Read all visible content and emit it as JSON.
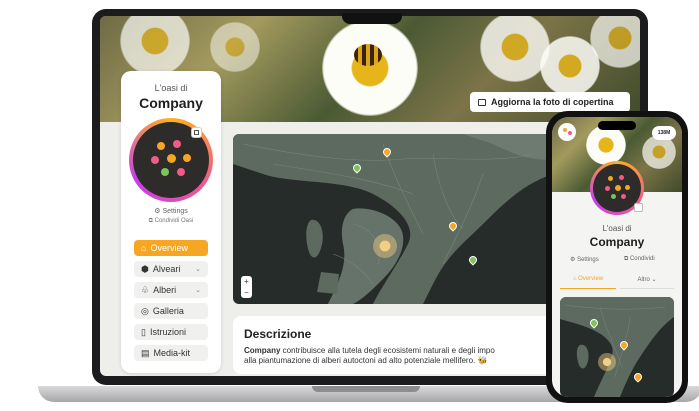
{
  "brand": {
    "accent": "#f7a623",
    "avatar_ring": [
      "#ffb21e",
      "#f15b86",
      "#c73cf0"
    ]
  },
  "desktop": {
    "cover_button": {
      "icon": "image-icon",
      "label": "Aggiorna la foto di copertina"
    },
    "sidebar": {
      "subtitle": "L'oasi di",
      "title": "Company",
      "settings": {
        "icon": "settings-icon",
        "label": "Settings"
      },
      "share": {
        "icon": "share-icon",
        "label": "Condividi Oasi"
      },
      "menu": [
        {
          "icon": "home-icon",
          "label": "Overview",
          "active": true,
          "dropdown": false
        },
        {
          "icon": "hive-icon",
          "label": "Alveari",
          "active": false,
          "dropdown": true
        },
        {
          "icon": "tree-icon",
          "label": "Alberi",
          "active": false,
          "dropdown": true
        },
        {
          "icon": "gallery-icon",
          "label": "Galleria",
          "active": false,
          "dropdown": false
        },
        {
          "icon": "document-icon",
          "label": "Istruzioni",
          "active": false,
          "dropdown": false
        },
        {
          "icon": "media-kit-icon",
          "label": "Media-kit",
          "active": false,
          "dropdown": false
        }
      ]
    },
    "map": {
      "zoom_in": "+",
      "zoom_out": "−"
    },
    "description": {
      "heading": "Descrizione",
      "company": "Company",
      "text_line1": " contribuisce alla tutela degli ecosistemi naturali e degli impo",
      "text_line2": "alla piantumazione di alberi autoctoni ad alto potenziale mellifero. 🐝"
    }
  },
  "phone": {
    "badge": "138M",
    "subtitle": "L'oasi di",
    "title": "Company",
    "settings": {
      "icon": "settings-icon",
      "label": "Settings"
    },
    "share": {
      "icon": "share-icon",
      "label": "Condividi"
    },
    "tabs": [
      {
        "icon": "home-icon",
        "label": "Overview",
        "active": true
      },
      {
        "label": "Altro",
        "icon": "chevron-down-icon",
        "active": false
      }
    ]
  }
}
